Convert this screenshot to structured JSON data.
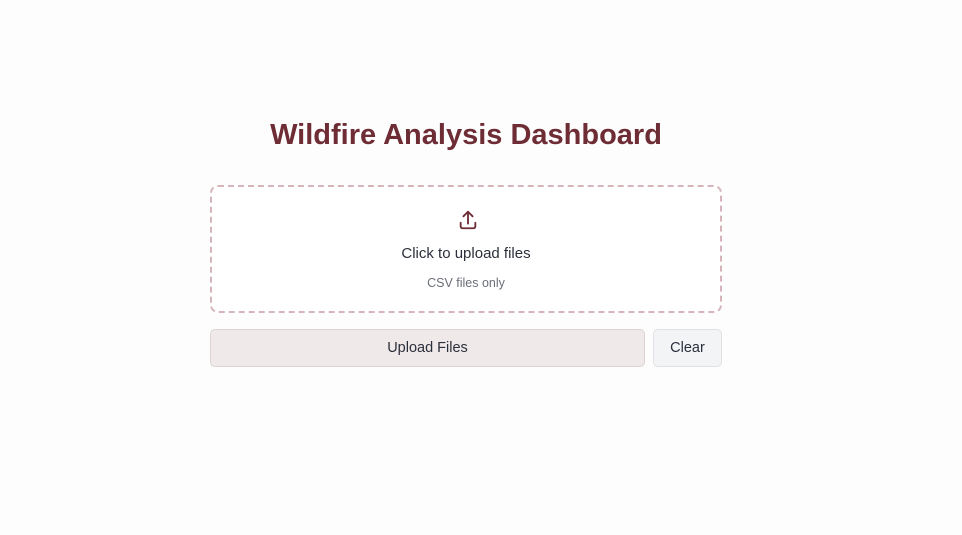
{
  "header": {
    "title": "Wildfire Analysis Dashboard"
  },
  "upload_area": {
    "icon": "upload-icon",
    "prompt": "Click to upload files",
    "hint": "CSV files only"
  },
  "actions": {
    "upload_label": "Upload Files",
    "clear_label": "Clear"
  },
  "colors": {
    "brand": "#6e2c35",
    "dropzone_border": "#d6b5ba",
    "upload_button_bg": "#efe9ea",
    "clear_button_bg": "#f3f4f6"
  }
}
